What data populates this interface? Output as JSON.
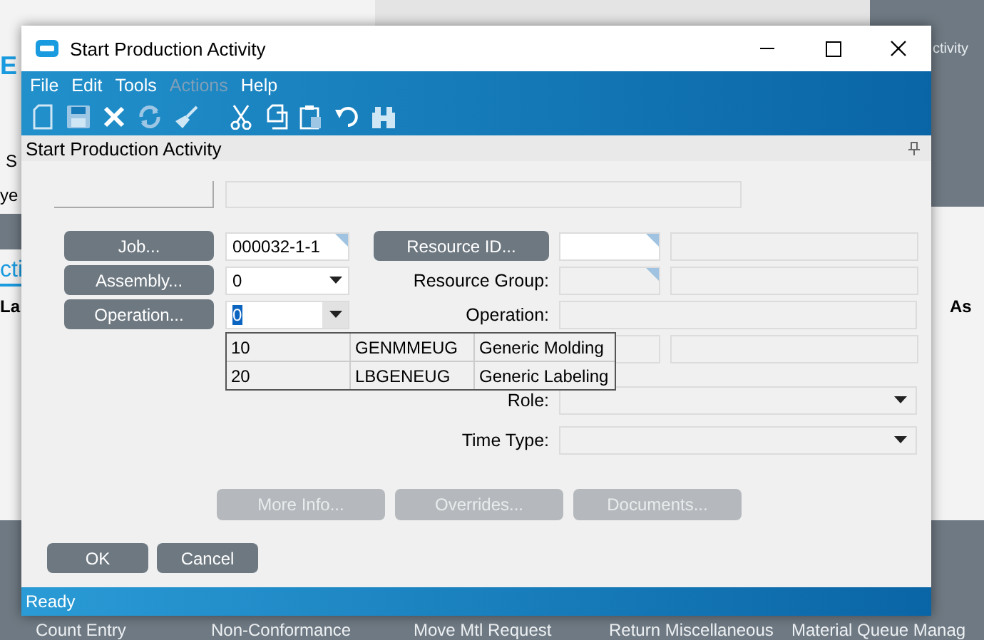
{
  "background": {
    "texts": [
      {
        "text": "E",
        "kind": "logo"
      },
      {
        "text": "S",
        "kind": "plain"
      },
      {
        "text": "ye",
        "kind": "plain"
      },
      {
        "text": "cti",
        "kind": "tab"
      },
      {
        "text": "La",
        "kind": "header"
      },
      {
        "text": "As",
        "kind": "header"
      },
      {
        "text": "ctivity",
        "kind": "tile"
      }
    ],
    "tiles": [
      "Count Entry",
      "Non-Conformance",
      "Move Mtl Request",
      "Return Miscellaneous",
      "Material Queue Manag"
    ]
  },
  "window": {
    "title": "Start Production Activity"
  },
  "menu": [
    {
      "label": "File",
      "disabled": false
    },
    {
      "label": "Edit",
      "disabled": false
    },
    {
      "label": "Tools",
      "disabled": false
    },
    {
      "label": "Actions",
      "disabled": true
    },
    {
      "label": "Help",
      "disabled": false
    }
  ],
  "form": {
    "title": "Start Production Activity",
    "left_rows": [
      {
        "button": "Job...",
        "kind": "text",
        "value": "000032-1-1",
        "highlighted": false
      },
      {
        "button": "Assembly...",
        "kind": "combo",
        "value": "0",
        "highlighted": false
      },
      {
        "button": "Operation...",
        "kind": "combo",
        "value": "0",
        "highlighted": true
      }
    ],
    "right_rows": [
      {
        "kind": "lookup_button",
        "label": "Resource ID..."
      },
      {
        "kind": "lookup",
        "label": "Resource Group:"
      },
      {
        "kind": "wide",
        "label": "Operation:"
      },
      {
        "kind": "lookup"
      },
      {
        "kind": "combo",
        "label": "Role:"
      },
      {
        "kind": "combo",
        "label": "Time Type:"
      }
    ],
    "dropdown": [
      {
        "operation": "10",
        "code": "GENMMEUG",
        "description": "Generic Molding"
      },
      {
        "operation": "20",
        "code": "LBGENEUG",
        "description": "Generic Labeling"
      }
    ],
    "action_buttons": [
      {
        "label": "More Info...",
        "disabled": true
      },
      {
        "label": "Overrides...",
        "disabled": true
      },
      {
        "label": "Documents...",
        "disabled": true
      }
    ],
    "footer_buttons": [
      {
        "label": "OK",
        "disabled": false
      },
      {
        "label": "Cancel",
        "disabled": false
      }
    ]
  },
  "status_bar": "Ready"
}
